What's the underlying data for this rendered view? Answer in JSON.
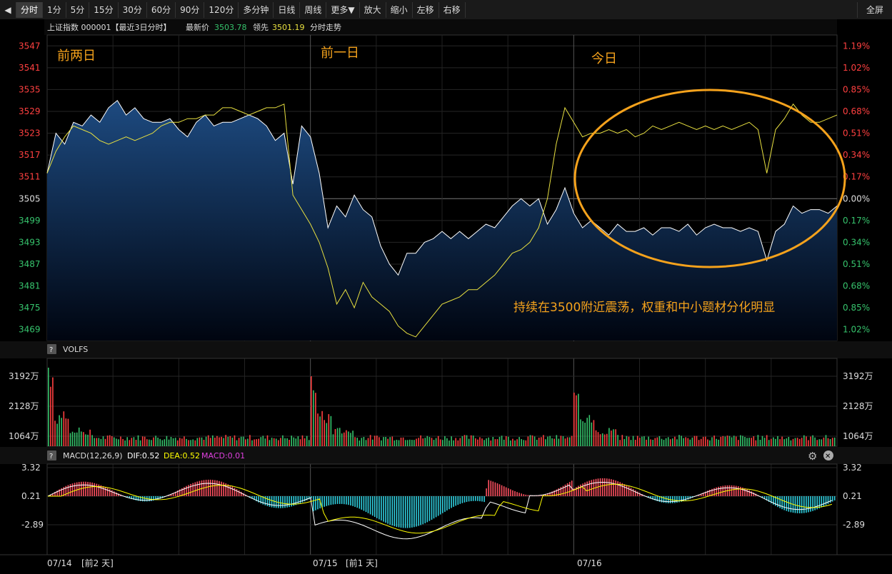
{
  "toolbar": {
    "back_icon": "◀",
    "items": [
      {
        "label": "分时",
        "active": true
      },
      {
        "label": "1分"
      },
      {
        "label": "5分"
      },
      {
        "label": "15分"
      },
      {
        "label": "30分"
      },
      {
        "label": "60分"
      },
      {
        "label": "90分"
      },
      {
        "label": "120分"
      },
      {
        "label": "多分钟"
      },
      {
        "label": "日线"
      },
      {
        "label": "周线"
      },
      {
        "label": "更多▼"
      },
      {
        "label": "放大"
      },
      {
        "label": "缩小"
      },
      {
        "label": "左移"
      },
      {
        "label": "右移"
      }
    ],
    "fullscreen": "全屏"
  },
  "header": {
    "index_name": "上证指数 000001【最近3日分时】",
    "latest_label": "最新价",
    "latest_value": "3503.78",
    "lead_label": "领先",
    "lead_value": "3501.19",
    "mode_label": "分时走势"
  },
  "annotations": {
    "day1": "前两日",
    "day2": "前一日",
    "day3": "今日",
    "comment": "持续在3500附近震荡，权重和中小题材分化明显"
  },
  "colors": {
    "up": "#ff4040",
    "down": "#36c36c",
    "price_line": "#ffffff",
    "lead_line": "#e8e040",
    "area_top": "#1d4a80",
    "accent": "#f5a21c",
    "macd_pos": "#ff5060",
    "macd_neg": "#30d0e0",
    "dea": "#ffff00",
    "macd_label": "#e040e0"
  },
  "volume_panel": {
    "title": "VOLFS",
    "ticks": [
      "3192万",
      "2128万",
      "1064万"
    ]
  },
  "macd_panel": {
    "title": "MACD(12,26,9)",
    "dif": "DIF:0.52",
    "dea": "DEA:0.52",
    "macd": "MACD:0.01",
    "ticks": [
      "3.32",
      "0.21",
      "-2.89"
    ],
    "gear_icon": "⚙",
    "close_icon": "✕"
  },
  "x_axis": {
    "labels": [
      {
        "date": "07/14",
        "tag": "[前2 天]"
      },
      {
        "date": "07/15",
        "tag": "[前1 天]"
      },
      {
        "date": "07/16",
        "tag": ""
      }
    ]
  },
  "chart_data": {
    "type": "line",
    "ylim": [
      3466,
      3550
    ],
    "base": 3505,
    "y_ticks": [
      "3547",
      "3541",
      "3535",
      "3529",
      "3523",
      "3517",
      "3511",
      "3505",
      "3499",
      "3493",
      "3487",
      "3481",
      "3475",
      "3469"
    ],
    "pct_ticks": [
      "1.19%",
      "1.02%",
      "0.85%",
      "0.68%",
      "0.51%",
      "0.34%",
      "0.17%",
      "0.00%",
      "0.17%",
      "0.34%",
      "0.51%",
      "0.68%",
      "0.85%",
      "1.02%"
    ],
    "series": [
      {
        "values": [
          3512,
          3523,
          3520,
          3526,
          3525,
          3528,
          3526,
          3530,
          3532,
          3528,
          3530,
          3527,
          3526,
          3526,
          3527,
          3524,
          3522,
          3526,
          3528,
          3525,
          3526,
          3526,
          3527,
          3528,
          3527,
          3525,
          3521,
          3523,
          3509,
          3525,
          3522,
          3512,
          3497,
          3503,
          3500,
          3506,
          3502,
          3500,
          3492,
          3487,
          3484,
          3490,
          3490,
          3493,
          3494,
          3496,
          3494,
          3496,
          3494,
          3496,
          3498,
          3497,
          3500,
          3503,
          3505,
          3503,
          3505,
          3498,
          3502,
          3508,
          3501,
          3497,
          3499,
          3497,
          3495,
          3498,
          3496,
          3496,
          3497,
          3495,
          3497,
          3497,
          3496,
          3498,
          3495,
          3497,
          3498,
          3497,
          3497,
          3496,
          3497,
          3496,
          3488,
          3496,
          3498,
          3503,
          3501,
          3502,
          3502,
          3501,
          3503
        ]
      },
      {
        "values": [
          3512,
          3518,
          3522,
          3525,
          3524,
          3523,
          3521,
          3520,
          3521,
          3522,
          3521,
          3522,
          3523,
          3525,
          3526,
          3526,
          3527,
          3527,
          3528,
          3528,
          3530,
          3530,
          3529,
          3528,
          3529,
          3530,
          3530,
          3531,
          3506,
          3502,
          3498,
          3493,
          3486,
          3476,
          3480,
          3475,
          3482,
          3478,
          3476,
          3474,
          3470,
          3468,
          3467,
          3470,
          3473,
          3476,
          3477,
          3478,
          3480,
          3480,
          3482,
          3484,
          3487,
          3490,
          3491,
          3493,
          3497,
          3505,
          3520,
          3530,
          3526,
          3522,
          3523,
          3523,
          3524,
          3523,
          3524,
          3522,
          3523,
          3525,
          3524,
          3525,
          3526,
          3525,
          3524,
          3525,
          3524,
          3525,
          3524,
          3525,
          3526,
          3524,
          3512,
          3524,
          3527,
          3531,
          3528,
          3526,
          3526,
          3527,
          3528
        ]
      }
    ]
  }
}
